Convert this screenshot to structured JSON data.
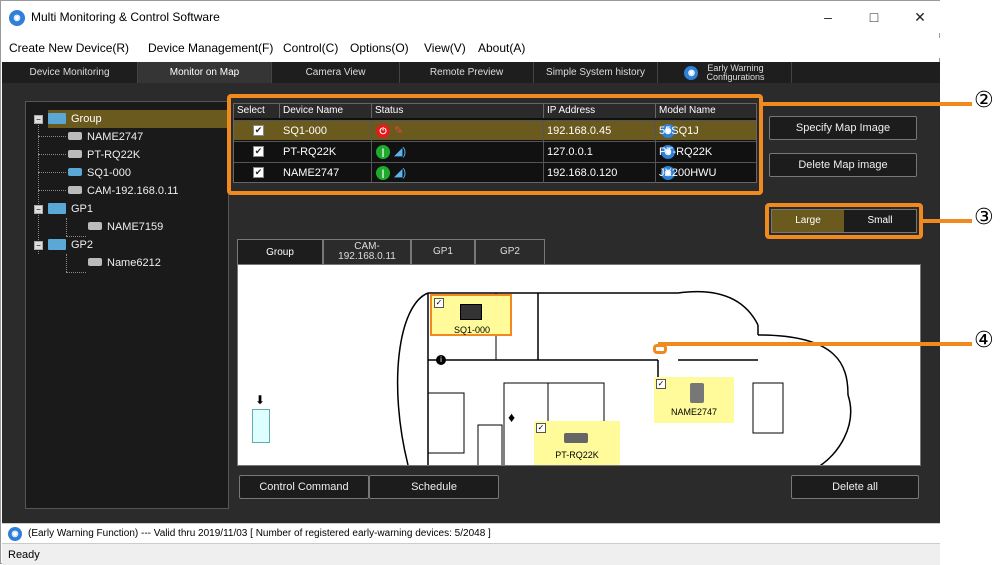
{
  "window": {
    "title": "Multi Monitoring & Control Software",
    "app_icon": "app-logo-icon",
    "minimize": "–",
    "maximize": "□",
    "close": "✕"
  },
  "menu": [
    "Create New Device(R)",
    "Device Management(F)",
    "Control(C)",
    "Options(O)",
    "View(V)",
    "About(A)"
  ],
  "tabs": [
    "Device Monitoring",
    "Monitor on Map",
    "Camera View",
    "Remote Preview",
    "Simple System history"
  ],
  "ew_tab": {
    "line1": "Early Warning",
    "line2": "Configurations"
  },
  "tree": [
    {
      "label": "Group",
      "type": "folder"
    },
    {
      "label": "NAME2747",
      "type": "camera"
    },
    {
      "label": "PT-RQ22K",
      "type": "projector"
    },
    {
      "label": "SQ1-000",
      "type": "display"
    },
    {
      "label": "CAM-192.168.0.11",
      "type": "camera"
    },
    {
      "label": "GP1",
      "type": "folder"
    },
    {
      "label": "NAME7159",
      "type": "projector"
    },
    {
      "label": "GP2",
      "type": "folder"
    },
    {
      "label": "Name6212",
      "type": "projector"
    }
  ],
  "table": {
    "headers": [
      "Select",
      "Device Name",
      "Status",
      "IP Address",
      "Model Name"
    ],
    "rows": [
      {
        "name": "SQ1-000",
        "ip": "192.168.0.45",
        "model": "55SQ1J",
        "power": "off"
      },
      {
        "name": "PT-RQ22K",
        "ip": "127.0.0.1",
        "model": "PT-RQ22K",
        "power": "on"
      },
      {
        "name": "NAME2747",
        "ip": "192.168.0.120",
        "model": "JX200HWU",
        "power": "on"
      }
    ]
  },
  "buttons": {
    "specify_map": "Specify Map Image",
    "delete_map": "Delete Map image",
    "large": "Large",
    "small": "Small",
    "control_command": "Control Command",
    "schedule": "Schedule",
    "delete_all": "Delete all"
  },
  "map_tabs": [
    {
      "l1": "Group",
      "l2": ""
    },
    {
      "l1": "CAM-",
      "l2": "192.168.0.11"
    },
    {
      "l1": "GP1",
      "l2": ""
    },
    {
      "l1": "GP2",
      "l2": ""
    }
  ],
  "map_devices": [
    {
      "name": "SQ1-000"
    },
    {
      "name": "PT-RQ22K"
    },
    {
      "name": "NAME2747"
    }
  ],
  "callouts": [
    "②",
    "③",
    "④"
  ],
  "footer": "(Early Warning Function) --- Valid thru 2019/11/03  [ Number of registered early-warning devices: 5/2048 ]",
  "status": "Ready",
  "colors": {
    "highlight": "#f08a1e",
    "selected": "#6b5a1d",
    "accent": "#2f80d8"
  }
}
